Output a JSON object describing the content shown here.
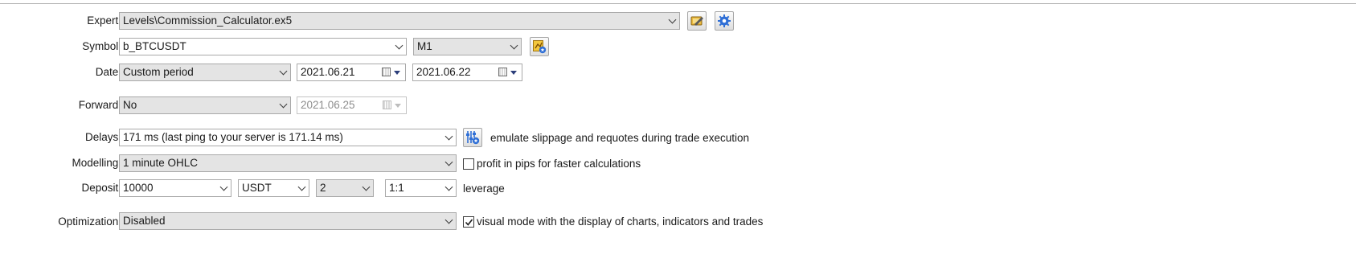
{
  "labels": {
    "expert": "Expert:",
    "symbol": "Symbol:",
    "date": "Date:",
    "forward": "Forward:",
    "delays": "Delays:",
    "modelling": "Modelling:",
    "deposit": "Deposit:",
    "optimization": "Optimization:"
  },
  "expert": {
    "value": "Levels\\Commission_Calculator.ex5"
  },
  "symbol": {
    "value": "b_BTCUSDT",
    "timeframe": "M1"
  },
  "date": {
    "mode": "Custom period",
    "from": "2021.06.21",
    "to": "2021.06.22"
  },
  "forward": {
    "mode": "No",
    "date": "2021.06.25"
  },
  "delays": {
    "value": "171 ms (last ping to your server is 171.14 ms)",
    "slippage_text": "emulate slippage and requotes during trade execution"
  },
  "modelling": {
    "value": "1 minute OHLC",
    "pips_checked": false,
    "pips_text": "profit in pips for faster calculations"
  },
  "deposit": {
    "amount": "10000",
    "currency": "USDT",
    "digits": "2",
    "leverage_value": "1:1",
    "leverage_text": "leverage"
  },
  "optimization": {
    "value": "Disabled",
    "visual_checked": true,
    "visual_text": "visual mode with the display of charts, indicators and trades"
  },
  "icons": {
    "expert_edit": "edit-expert-icon",
    "expert_settings": "gear-icon",
    "symbol_properties": "symbol-properties-icon",
    "delays_settings": "delays-settings-icon"
  },
  "colors": {
    "field_gray": "#e4e4e4",
    "icon_blue": "#2f6fd6",
    "icon_gold": "#d6a11e"
  }
}
